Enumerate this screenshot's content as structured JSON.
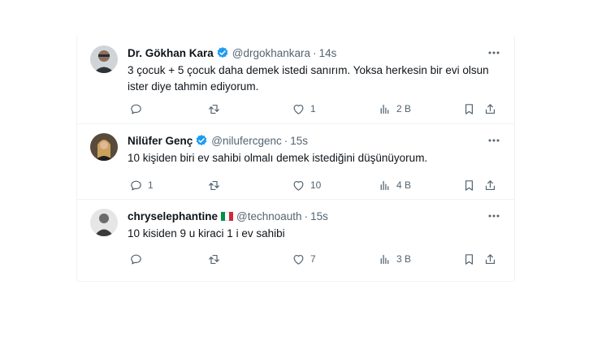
{
  "tweets": [
    {
      "name": "Dr. Gökhan Kara",
      "handle": "@drgokhankara",
      "time": "14s",
      "text": "3 çocuk + 5 çocuk daha demek istedi sanırım. Yoksa herkesin bir evi olsun ister diye tahmin ediyorum.",
      "replies": "",
      "retweets": "",
      "likes": "1",
      "views": "2 B",
      "verified": true,
      "flag": false
    },
    {
      "name": "Nilüfer Genç",
      "handle": "@nilufercgenc",
      "time": "15s",
      "text": "10 kişiden biri ev sahibi olmalı demek istediğini düşünüyorum.",
      "replies": "1",
      "retweets": "",
      "likes": "10",
      "views": "4 B",
      "verified": true,
      "flag": false
    },
    {
      "name": "chryselephantine",
      "handle": "@technoauth",
      "time": "15s",
      "text": "10 kisiden 9 u kiraci 1 i ev sahibi",
      "replies": "",
      "retweets": "",
      "likes": "7",
      "views": "3 B",
      "verified": false,
      "flag": true
    }
  ],
  "separator": "·",
  "colors": {
    "verified_badge": "#1d9bf0",
    "secondary_text": "#536471",
    "divider": "#eff3f4",
    "flag": [
      "#009246",
      "#ffffff",
      "#ce2b37"
    ]
  },
  "icons": [
    "verified-badge-icon",
    "more-options-icon",
    "reply-icon",
    "retweet-icon",
    "like-icon",
    "views-icon",
    "bookmark-icon",
    "share-icon"
  ]
}
